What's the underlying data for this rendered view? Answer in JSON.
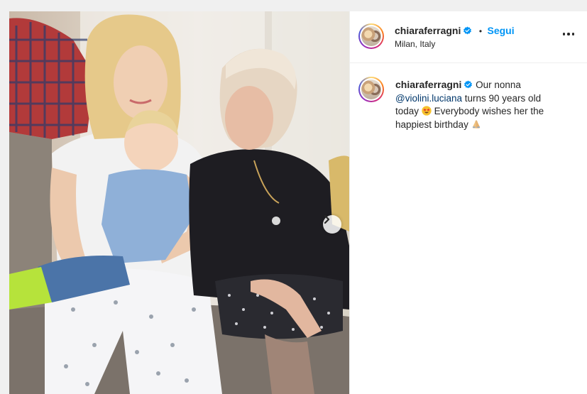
{
  "post": {
    "author": {
      "username": "chiaraferragni",
      "location": "Milan, Italy",
      "follow_label": "Segui",
      "separator": "•",
      "verified": true
    },
    "caption": {
      "username": "chiaraferragni",
      "text_before_mention": "Our nonna",
      "mention": "@violini.luciana",
      "text_after_mention": "turns 90 years old today",
      "text_after_emoji": "Everybody wishes her the happiest birthday",
      "emojis": [
        "star-struck-emoji",
        "folded-hands-emoji"
      ]
    },
    "icons": {
      "verified": "verified-badge-icon",
      "more": "more-options-icon",
      "next": "chevron-right-icon"
    },
    "colors": {
      "follow_blue": "#0095f6",
      "mention_blue": "#00376b",
      "verified_blue": "#0095f6"
    }
  }
}
